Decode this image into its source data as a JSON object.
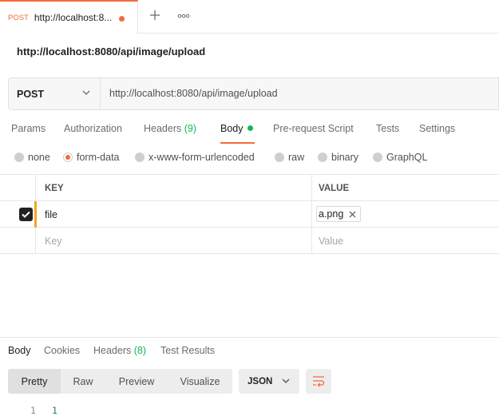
{
  "tab": {
    "method": "POST",
    "url": "http://localhost:8...",
    "more_icon": "more-horizontal-icon",
    "plus_icon": "plus-icon"
  },
  "request": {
    "title": "http://localhost:8080/api/image/upload",
    "method": "POST",
    "url": "http://localhost:8080/api/image/upload"
  },
  "request_tabs": [
    {
      "label": "Params"
    },
    {
      "label": "Authorization"
    },
    {
      "label": "Headers",
      "count": "(9)"
    },
    {
      "label": "Body",
      "active": true
    },
    {
      "label": "Pre-request Script"
    },
    {
      "label": "Tests"
    },
    {
      "label": "Settings"
    }
  ],
  "body_modes": [
    {
      "label": "none",
      "checked": false
    },
    {
      "label": "form-data",
      "checked": true
    },
    {
      "label": "x-www-form-urlencoded",
      "checked": false
    },
    {
      "label": "raw",
      "checked": false
    },
    {
      "label": "binary",
      "checked": false
    },
    {
      "label": "GraphQL",
      "checked": false
    }
  ],
  "params_table": {
    "headers": {
      "key": "KEY",
      "value": "VALUE"
    },
    "rows": [
      {
        "checked": true,
        "key": "file",
        "value": "a.png"
      }
    ],
    "placeholder": {
      "key": "Key",
      "value": "Value"
    }
  },
  "response_tabs": [
    {
      "label": "Body",
      "active": true
    },
    {
      "label": "Cookies"
    },
    {
      "label": "Headers",
      "count": "(8)"
    },
    {
      "label": "Test Results"
    }
  ],
  "response_view": {
    "modes": [
      "Pretty",
      "Raw",
      "Preview",
      "Visualize"
    ],
    "active": "Pretty",
    "format": "JSON"
  },
  "response_body": {
    "line_number": "1",
    "value": "1"
  },
  "colors": {
    "accent": "#f26b3a",
    "green": "#0cbb52",
    "row_accent": "#f5a623"
  }
}
